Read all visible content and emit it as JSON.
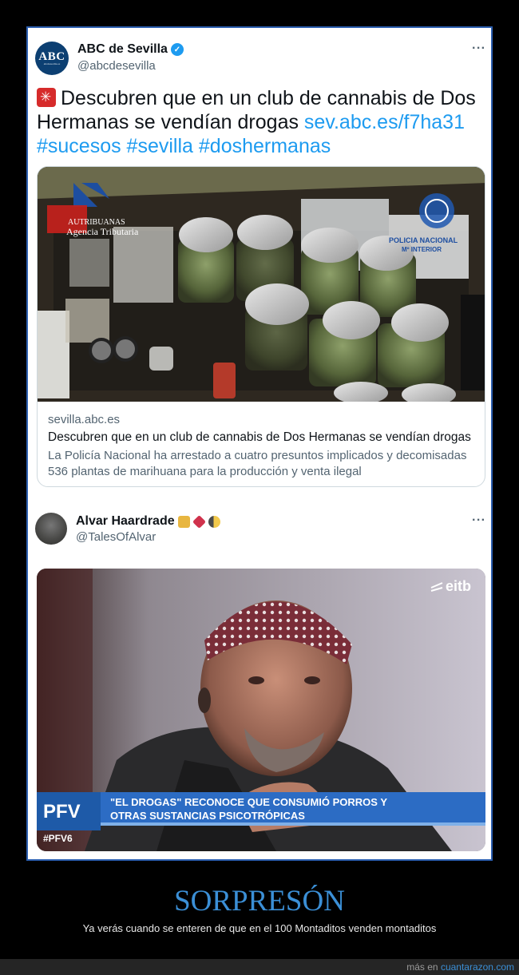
{
  "tweet1": {
    "avatar_text": "ABC",
    "avatar_subtext": "abcdesevilla.es",
    "name": "ABC de Sevilla",
    "handle": "@abcdesevilla",
    "more": "···",
    "text_main": "Descubren que en un club de cannabis de Dos Hermanas se vendían drogas",
    "link": "sev.abc.es/f7ha31",
    "hashtags": "#sucesos #sevilla #doshermanas",
    "card": {
      "image_overlay_left": "Agencia Tributaria",
      "image_overlay_left_small": "AUTRIBUANAS",
      "image_overlay_right_1": "POLICIA NACIONAL",
      "image_overlay_right_2": "Mº INTERIOR",
      "domain": "sevilla.abc.es",
      "title": "Descubren que en un club de cannabis de Dos Hermanas se vendían drogas",
      "description": "La Policía Nacional ha arrestado a cuatro presuntos implicados y decomisadas 536 plantas de marihuana para la producción y venta ilegal"
    }
  },
  "tweet2": {
    "name": "Alvar Haardrade",
    "handle": "@TalesOfAlvar",
    "more": "···",
    "photo": {
      "channel": "eitb",
      "program": "PFV",
      "program_tag": "#PFV6",
      "caption_line1": "\"EL DROGAS\" RECONOCE QUE CONSUMIÓ PORROS Y",
      "caption_line2": "OTRAS SUSTANCIAS PSICOTRÓPICAS"
    }
  },
  "footer": {
    "heading": "SORPRESÓN",
    "caption": "Ya verás cuando se enteren de que en el 100 Montaditos venden montaditos",
    "more_prefix": "más en",
    "more_link": "cuantarazon.com"
  },
  "colors": {
    "accent": "#1d9bf0",
    "frame_border": "#2c5fb0",
    "heading": "#3b8fd6",
    "page_bg": "#000000"
  }
}
